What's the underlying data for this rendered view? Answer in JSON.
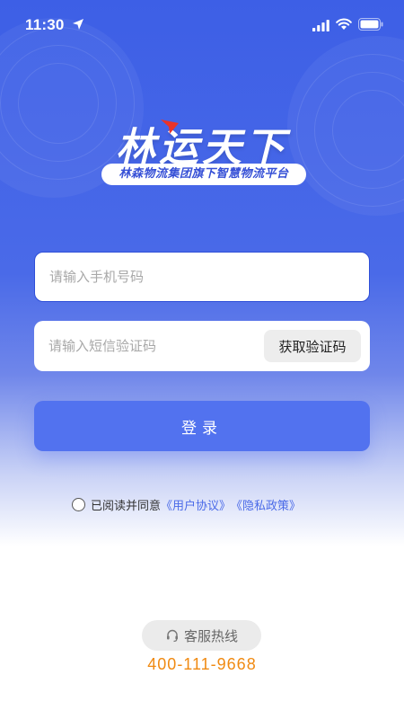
{
  "status_bar": {
    "time": "11:30"
  },
  "brand": {
    "title": "林运天下",
    "slogan": "林森物流集团旗下智慧物流平台"
  },
  "form": {
    "phone_placeholder": "请输入手机号码",
    "code_placeholder": "请输入短信验证码",
    "get_code_label": "获取验证码",
    "login_label": "登录"
  },
  "agreement": {
    "prefix": "已阅读并同意",
    "user_agreement": "《用户协议》",
    "privacy_policy": "《隐私政策》"
  },
  "support": {
    "hotline_label": "客服热线",
    "hotline_number": "400-111-9668"
  },
  "colors": {
    "primary": "#5272ef",
    "accent": "#f08a12",
    "link": "#4a6ae8"
  }
}
